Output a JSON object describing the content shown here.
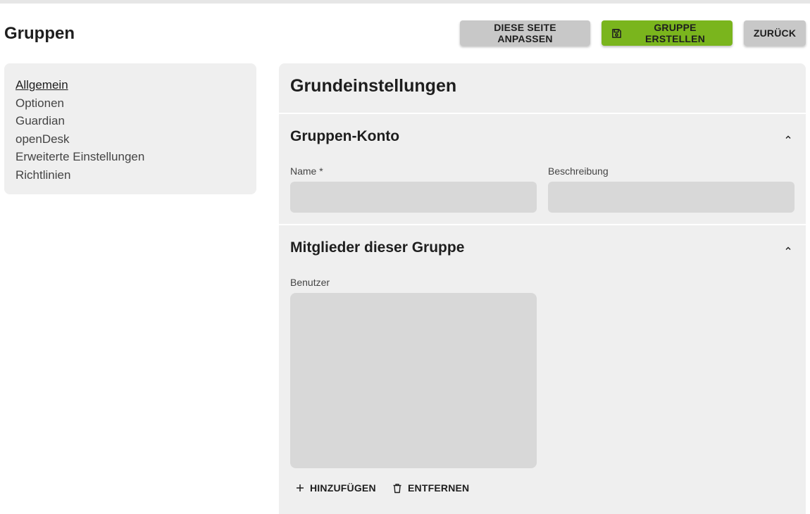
{
  "page": {
    "title": "Gruppen"
  },
  "toolbar": {
    "customize_label": "DIESE SEITE ANPASSEN",
    "create_label": "GRUPPE ERSTELLEN",
    "back_label": "ZURÜCK",
    "create_icon": "save-icon",
    "create_color": "#7ab51d",
    "neutral_color": "#c8c8c8"
  },
  "sidebar": {
    "items": [
      {
        "label": "Allgemein",
        "active": true
      },
      {
        "label": "Optionen",
        "active": false
      },
      {
        "label": "Guardian",
        "active": false
      },
      {
        "label": "openDesk",
        "active": false
      },
      {
        "label": "Erweiterte Einstellungen",
        "active": false
      },
      {
        "label": "Richtlinien",
        "active": false
      }
    ]
  },
  "main": {
    "title": "Grundeinstellungen",
    "account_section": {
      "title": "Gruppen-Konto",
      "name_label": "Name *",
      "name_value": "",
      "description_label": "Beschreibung",
      "description_value": ""
    },
    "members_section": {
      "title": "Mitglieder dieser Gruppe",
      "users_label": "Benutzer",
      "add_label": "HINZUFÜGEN",
      "remove_label": "ENTFERNEN",
      "add_icon": "plus-icon",
      "remove_icon": "trash-icon"
    }
  }
}
